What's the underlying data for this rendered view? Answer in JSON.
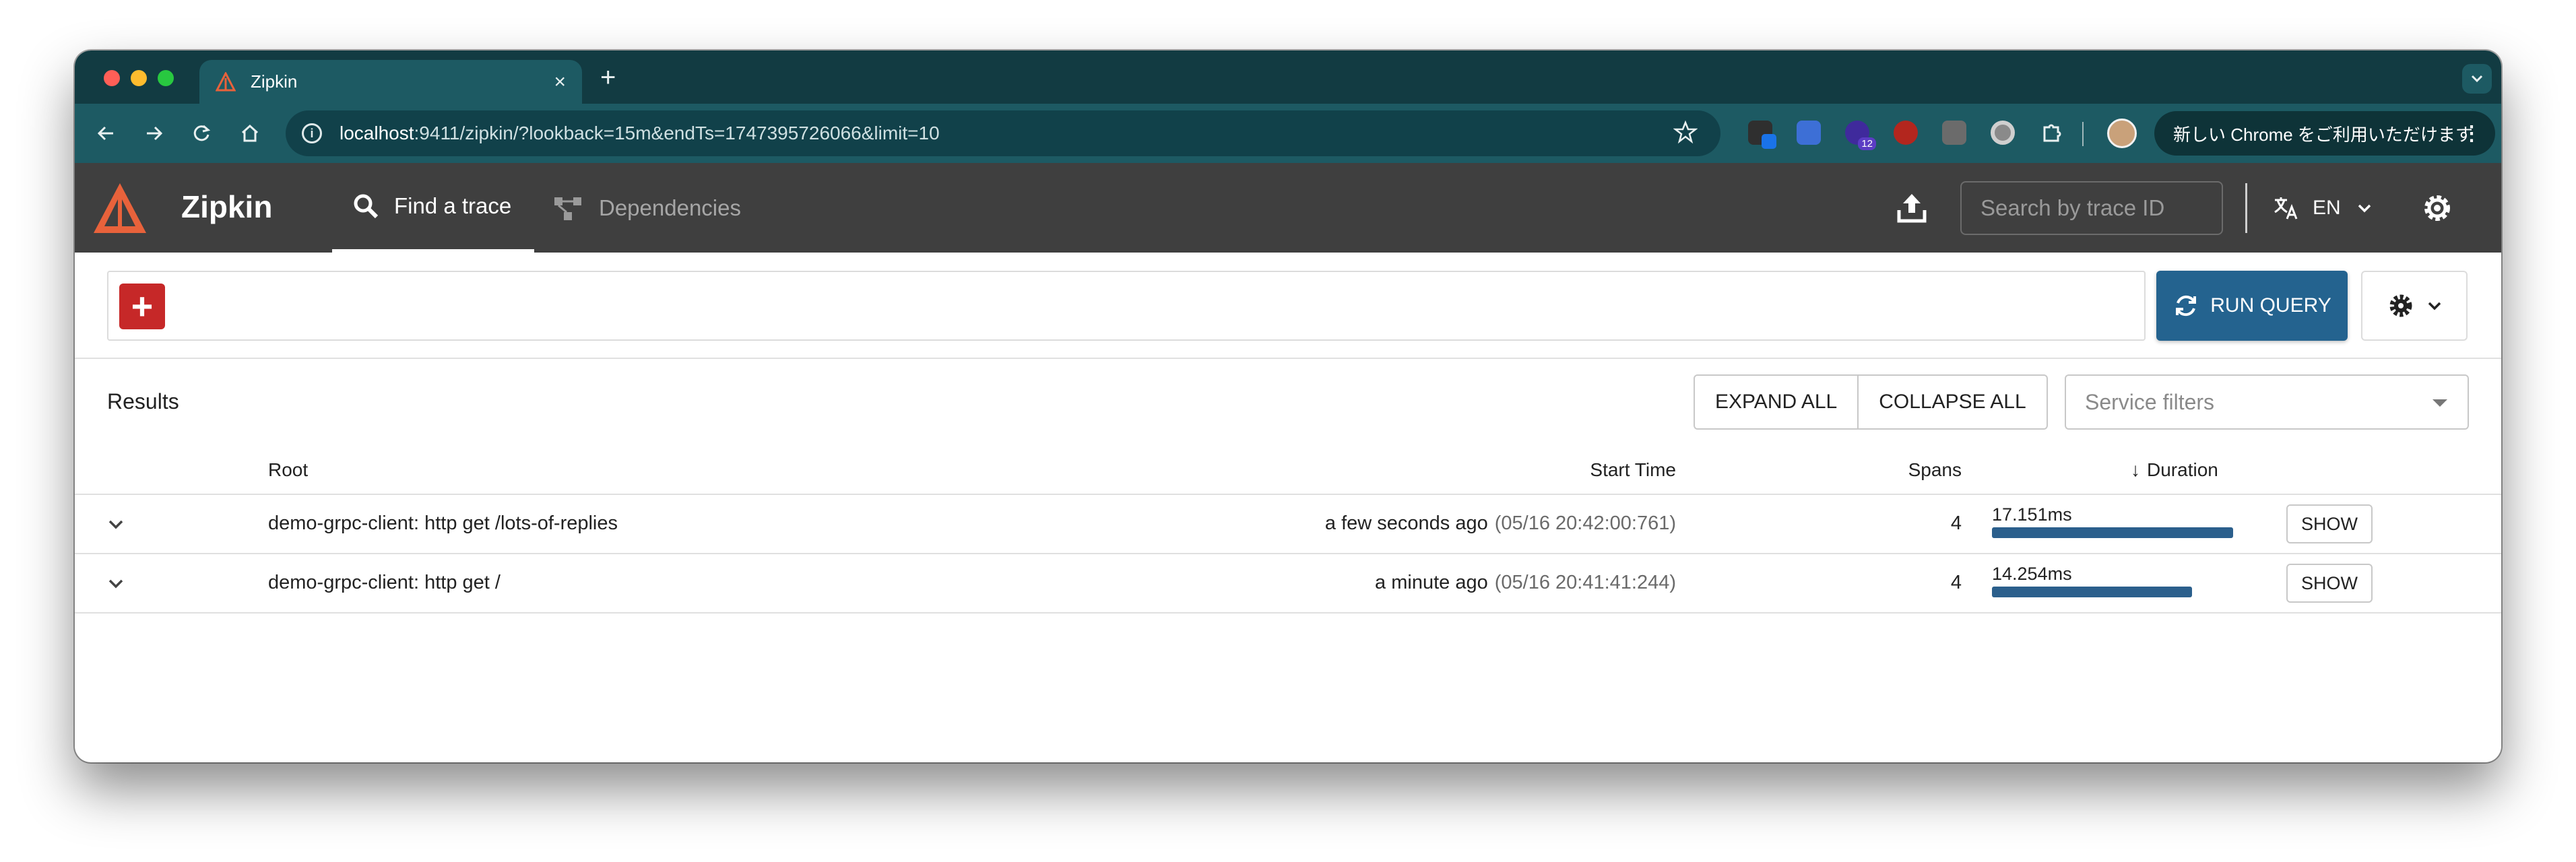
{
  "browser": {
    "tab_title": "Zipkin",
    "new_tab": "+",
    "close": "×",
    "url_host": "localhost",
    "url_rest": ":9411/zipkin/?lookback=15m&endTs=1747395726066&limit=10",
    "chrome_promo": "新しい Chrome をご利用いただけます",
    "ext_badge_1": "12"
  },
  "app": {
    "brand": "Zipkin",
    "nav": {
      "find_trace": "Find a trace",
      "dependencies": "Dependencies"
    },
    "search_placeholder": "Search by trace ID",
    "language": "EN"
  },
  "query": {
    "add_label": "+",
    "run_query_label": "RUN QUERY"
  },
  "results": {
    "title": "Results",
    "expand_all": "EXPAND ALL",
    "collapse_all": "COLLAPSE ALL",
    "service_filters_placeholder": "Service filters",
    "columns": {
      "root": "Root",
      "start_time": "Start Time",
      "spans": "Spans",
      "duration": "Duration",
      "sort_indicator": "↓"
    },
    "rows": [
      {
        "root": "demo-grpc-client: http get /lots-of-replies",
        "relative_time": "a few seconds ago",
        "timestamp": "(05/16 20:42:00:761)",
        "spans": "4",
        "duration": "17.151ms",
        "duration_fraction": 1.0,
        "show": "SHOW"
      },
      {
        "root": "demo-grpc-client: http get /",
        "relative_time": "a minute ago",
        "timestamp": "(05/16 20:41:41:244)",
        "spans": "4",
        "duration": "14.254ms",
        "duration_fraction": 0.831,
        "show": "SHOW"
      }
    ]
  },
  "colors": {
    "tab_strip": "#123b42",
    "toolbar": "#1d5a63",
    "app_header": "#3f3f3f",
    "zipkin_orange": "#e8623b",
    "run_query": "#24638f",
    "add_button": "#c62828",
    "duration_bar": "#2b5f8c"
  }
}
